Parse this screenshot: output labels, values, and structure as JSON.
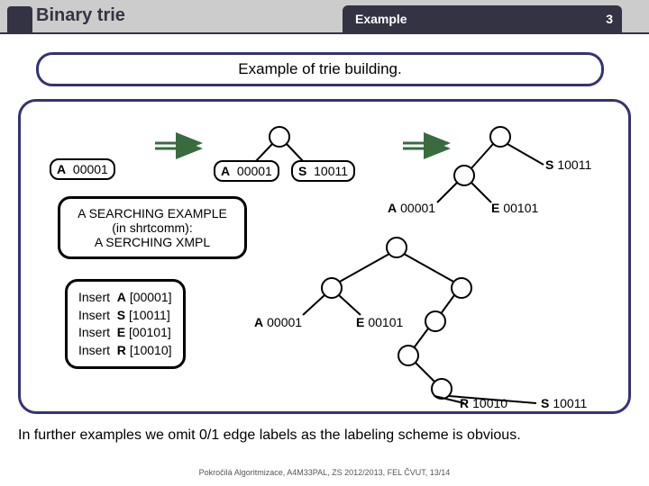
{
  "header": {
    "title": "Binary trie",
    "tab": "Example",
    "page": "3"
  },
  "section": {
    "text": "Example of trie building."
  },
  "labels": {
    "a1": {
      "letter": "A",
      "code": "00001"
    },
    "a2": {
      "letter": "A",
      "code": "00001"
    },
    "s2": {
      "letter": "S",
      "code": "10011"
    },
    "slone": {
      "letter": "S",
      "code": "10011"
    },
    "a3": {
      "letter": "A",
      "code": "00001"
    },
    "e3": {
      "letter": "E",
      "code": "00101"
    },
    "a4": {
      "letter": "A",
      "code": "00001"
    },
    "e4": {
      "letter": "E",
      "code": "00101"
    },
    "r4": {
      "letter": "R",
      "code": "10010"
    },
    "s4": {
      "letter": "S",
      "code": "10011"
    }
  },
  "textbox": {
    "line1": "A SEARCHING EXAMPLE",
    "line2": "(in shrtcomm):",
    "line3": "A SERCHING XMPL"
  },
  "inserts": [
    {
      "kw": "Insert",
      "ch": "A",
      "code": "[00001]"
    },
    {
      "kw": "Insert",
      "ch": "S",
      "code": "[10011]"
    },
    {
      "kw": "Insert",
      "ch": "E",
      "code": "[00101]"
    },
    {
      "kw": "Insert",
      "ch": "R",
      "code": "[10010]"
    }
  ],
  "footer": {
    "main": "In further examples we omit 0/1 edge labels as the labeling scheme is obvious.",
    "small": "Pokročilá Algoritmizace, A4M33PAL, ZS 2012/2013, FEL ČVUT, 13/14"
  }
}
